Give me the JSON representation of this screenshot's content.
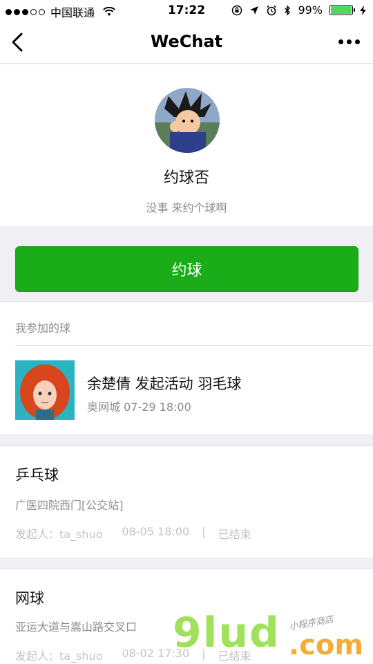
{
  "status_bar": {
    "carrier": "中国联通",
    "time": "17:22",
    "battery": "99%",
    "battery_level": 0.99
  },
  "nav": {
    "title": "WeChat"
  },
  "profile": {
    "name": "约球否",
    "description": "没事 来约个球啊"
  },
  "main_button": {
    "label": "约球"
  },
  "joined": {
    "header": "我参加的球",
    "item": {
      "title": "余楚倩 发起活动 羽毛球",
      "subtitle": "奥网城 07-29 18:00"
    }
  },
  "activities": [
    {
      "title": "乒乓球",
      "location": "广医四院西门[公交站]",
      "initiator": "发起人：ta_shuo",
      "time": "08-05 18:00",
      "separator": "|",
      "status": "已结束"
    },
    {
      "title": "网球",
      "location": "亚运大道与嵩山路交叉口",
      "initiator": "发起人：ta_shuo",
      "time": "08-02 17:30",
      "separator": "|",
      "status": "已结束"
    }
  ],
  "watermark": {
    "brand": "9lud",
    "domain": ".com",
    "tagline": "小程序商店"
  },
  "colors": {
    "accent": "#1aad19",
    "background": "#efeff4"
  }
}
